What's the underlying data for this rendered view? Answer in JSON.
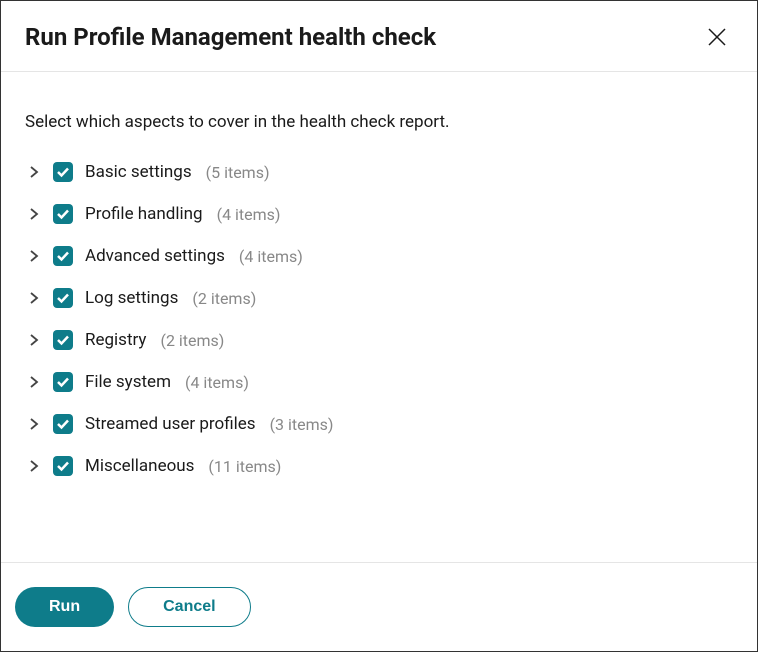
{
  "title": "Run Profile Management health check",
  "instruction": "Select which aspects to cover in the health check report.",
  "items": [
    {
      "label": "Basic settings",
      "count": "(5 items)"
    },
    {
      "label": "Profile handling",
      "count": "(4 items)"
    },
    {
      "label": "Advanced settings",
      "count": "(4 items)"
    },
    {
      "label": "Log settings",
      "count": "(2 items)"
    },
    {
      "label": "Registry",
      "count": "(2 items)"
    },
    {
      "label": "File system",
      "count": "(4 items)"
    },
    {
      "label": "Streamed user profiles",
      "count": "(3 items)"
    },
    {
      "label": "Miscellaneous",
      "count": "(11 items)"
    }
  ],
  "buttons": {
    "run": "Run",
    "cancel": "Cancel"
  }
}
